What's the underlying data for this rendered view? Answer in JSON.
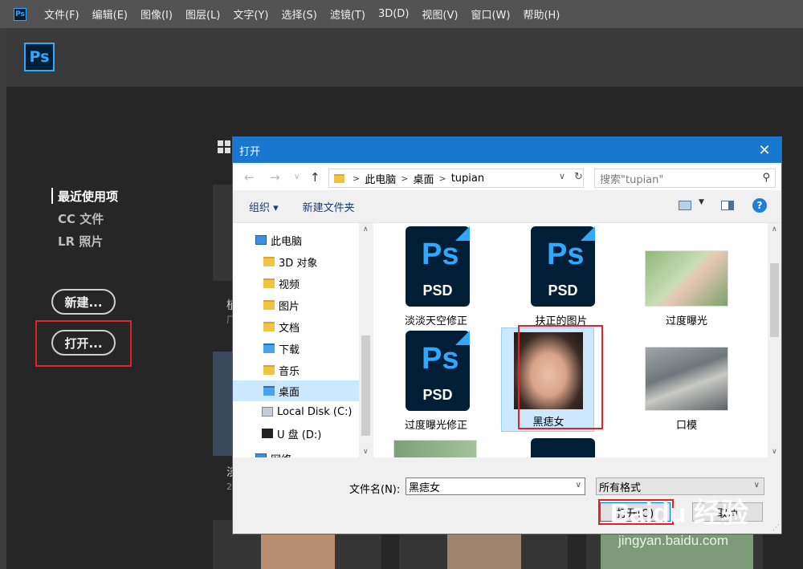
{
  "app": {
    "mini_logo": "Ps",
    "logo": "Ps",
    "menu": [
      "文件(F)",
      "编辑(E)",
      "图像(I)",
      "图层(L)",
      "文字(Y)",
      "选择(S)",
      "滤镜(T)",
      "3D(D)",
      "视图(V)",
      "窗口(W)",
      "帮助(H)"
    ]
  },
  "home": {
    "nav": {
      "recent": "最近使用项",
      "cc": "CC 文件",
      "lr": "LR 照片"
    },
    "new_button": "新建...",
    "open_button": "打开...",
    "bg_fragments": [
      "植",
      "厂",
      "淡",
      "2"
    ]
  },
  "dialog": {
    "title": "打开",
    "close": "✕",
    "address": {
      "crumbs": [
        "此电脑",
        "桌面",
        "tupian"
      ],
      "separator": ">"
    },
    "search_placeholder": "搜索\"tupian\"",
    "toolbar": {
      "organize": "组织 ▾",
      "new_folder": "新建文件夹",
      "help": "?"
    },
    "tree": [
      {
        "label": "此电脑",
        "icon": "computer-icon"
      },
      {
        "label": "3D 对象",
        "icon": "folder-icon"
      },
      {
        "label": "视频",
        "icon": "folder-icon"
      },
      {
        "label": "图片",
        "icon": "folder-icon"
      },
      {
        "label": "文档",
        "icon": "folder-icon"
      },
      {
        "label": "下载",
        "icon": "folder-icon"
      },
      {
        "label": "音乐",
        "icon": "folder-icon"
      },
      {
        "label": "桌面",
        "icon": "folder-icon",
        "selected": true
      },
      {
        "label": "Local Disk (C:)",
        "icon": "drive-icon"
      },
      {
        "label": "U 盘 (D:)",
        "icon": "usb-icon"
      },
      {
        "label": "网络",
        "icon": "network-icon"
      }
    ],
    "files": [
      {
        "label": "淡淡天空修正",
        "kind": "psd"
      },
      {
        "label": "扶正的图片",
        "kind": "psd"
      },
      {
        "label": "过度曝光",
        "kind": "photo"
      },
      {
        "label": "过度曝光修正",
        "kind": "psd"
      },
      {
        "label": "黑痣女",
        "kind": "photo",
        "selected": true
      },
      {
        "label": "口模",
        "kind": "photo"
      }
    ],
    "psd_text": {
      "ps": "Ps",
      "ext": "PSD"
    },
    "filename_label": "文件名(N):",
    "filename_value": "黑痣女",
    "filetype_value": "所有格式",
    "open_button": "打开(O)",
    "cancel_button": "取消"
  },
  "watermark": {
    "main": "Baidu 经验",
    "sub": "jingyan.baidu.com"
  }
}
